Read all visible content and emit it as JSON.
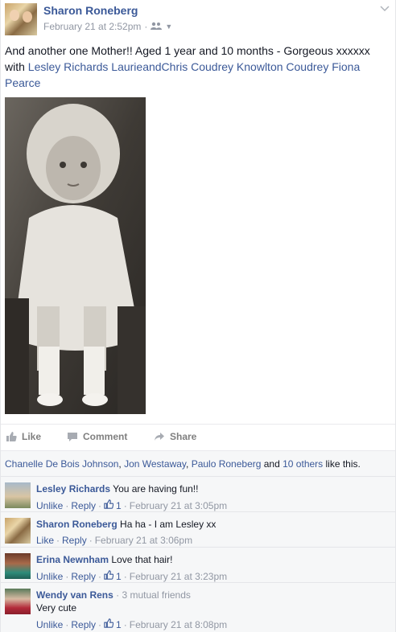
{
  "post": {
    "author": "Sharon Roneberg",
    "timestamp": "February 21 at 2:52pm",
    "audience_icon": "friends-icon",
    "menu_icon": "chevron-down-icon",
    "text_prefix": "And another one Mother!! Aged 1 year and 10 months - Gorgeous xxxxxx with ",
    "tagged": "Lesley Richards LaurieandChris Coudrey Knowlton Coudrey Fiona Pearce"
  },
  "actions": {
    "like": "Like",
    "comment": "Comment",
    "share": "Share"
  },
  "likes_summary": {
    "names": [
      "Chanelle De Bois Johnson",
      "Jon Westaway",
      "Paulo Roneberg"
    ],
    "separator": ", ",
    "and": " and ",
    "others": "10 others",
    "suffix": " like this."
  },
  "comments": [
    {
      "name": "Lesley Richards",
      "text": "You are having fun!!",
      "extra": "",
      "line2_text": "",
      "actions": [
        "Unlike",
        "Reply"
      ],
      "like_count": "1",
      "time": "February 21 at 3:05pm"
    },
    {
      "name": "Sharon Roneberg",
      "text": "Ha ha - I am Lesley xx",
      "extra": "",
      "line2_text": "",
      "actions": [
        "Like",
        "Reply"
      ],
      "like_count": "",
      "time": "February 21 at 3:06pm"
    },
    {
      "name": "Erina Newnham",
      "text": "Love that hair!",
      "extra": "",
      "line2_text": "",
      "actions": [
        "Unlike",
        "Reply"
      ],
      "like_count": "1",
      "time": "February 21 at 3:23pm"
    },
    {
      "name": "Wendy van Rens",
      "text": "",
      "extra": "3 mutual friends",
      "line2_text": "Very cute",
      "actions": [
        "Unlike",
        "Reply"
      ],
      "like_count": "1",
      "time": "February 21 at 8:08pm"
    }
  ],
  "separators": {
    "dot": " · "
  },
  "colors": {
    "link": "#3b5998",
    "muted": "#9197a3",
    "bg": "#f6f7f8"
  }
}
